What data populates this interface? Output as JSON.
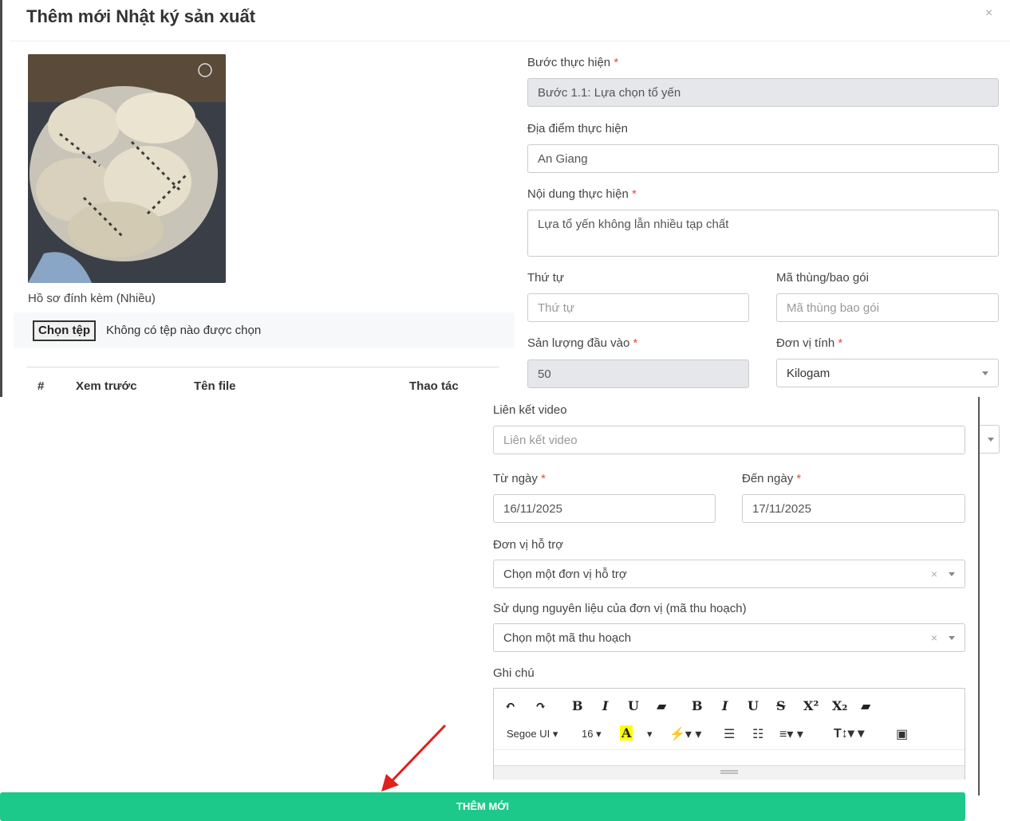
{
  "modal": {
    "title": "Thêm mới Nhật ký sản xuất",
    "close": "×"
  },
  "attachments": {
    "label": "Hồ sơ đính kèm (Nhiều)",
    "choose_button": "Chọn tệp",
    "no_file": "Không có tệp nào được chọn",
    "columns": [
      "#",
      "Xem trước",
      "Tên file",
      "Thao tác"
    ]
  },
  "form": {
    "step": {
      "label": "Bước thực hiện",
      "value": "Bước 1.1: Lựa chọn tổ yến"
    },
    "location": {
      "label": "Địa điểm thực hiện",
      "value": "An Giang"
    },
    "content": {
      "label": "Nội dung thực hiện",
      "value": "Lựa tổ yến không lẫn nhiều tạp chất"
    },
    "order": {
      "label": "Thứ tự",
      "placeholder": "Thứ tự"
    },
    "package_code": {
      "label": "Mã thùng/bao gói",
      "placeholder": "Mã thùng bao gói"
    },
    "input_qty": {
      "label": "Sản lượng đầu vào",
      "value": "50"
    },
    "unit": {
      "label": "Đơn vị tính",
      "value": "Kilogam"
    },
    "video": {
      "label": "Liên kết video",
      "placeholder": "Liên kết video"
    },
    "from_date": {
      "label": "Từ ngày",
      "value": "16/11/2025"
    },
    "to_date": {
      "label": "Đến ngày",
      "value": "17/11/2025"
    },
    "support_unit": {
      "label": "Đơn vị hỗ trợ",
      "value": "Chọn một đơn vị hỗ trợ"
    },
    "material": {
      "label": "Sử dụng nguyên liệu của đơn vị (mã thu hoạch)",
      "value": "Chọn một mã thu hoạch"
    },
    "note": {
      "label": "Ghi chú"
    },
    "required_mark": "*"
  },
  "editor": {
    "font": "Segoe UI",
    "size": "16",
    "row1": [
      "↶",
      "↷",
      "B",
      "I",
      "U",
      "▰",
      "B",
      "I",
      "U",
      "S",
      "X²",
      "X₂",
      "▰"
    ],
    "color_a": "A"
  },
  "submit_label": "THÊM MỚI",
  "colors": {
    "accent": "#1dc98a",
    "arrow": "#e0201c"
  }
}
